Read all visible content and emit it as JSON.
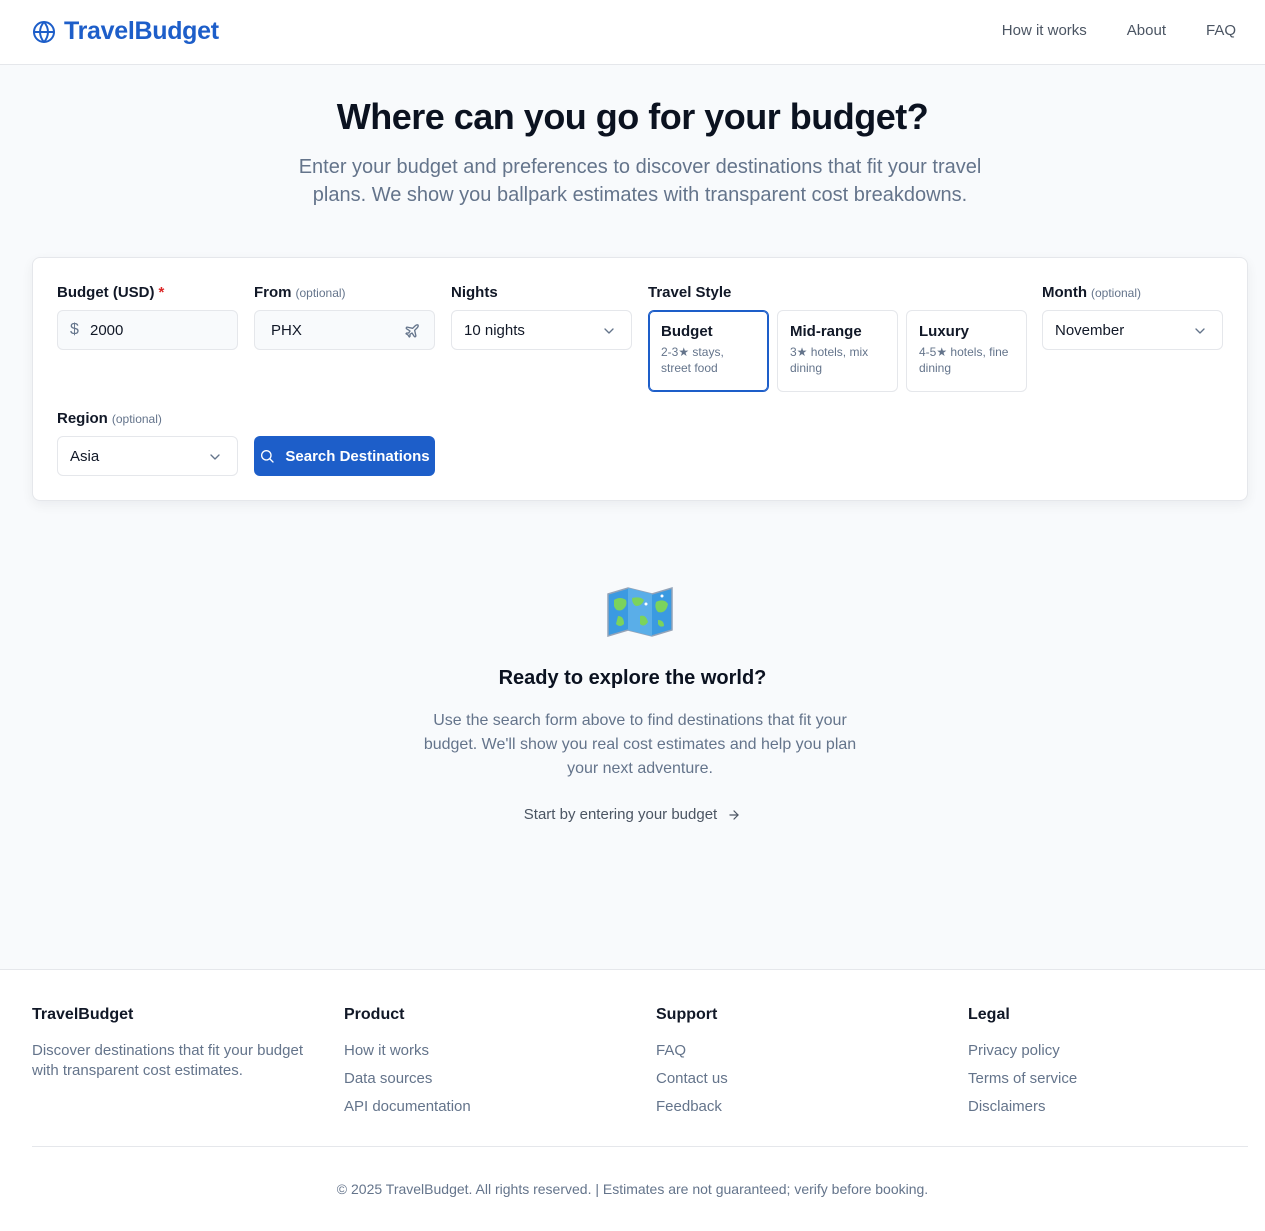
{
  "header": {
    "brand": "TravelBudget",
    "nav": [
      "How it works",
      "About",
      "FAQ"
    ]
  },
  "hero": {
    "title": "Where can you go for your budget?",
    "subtitle": "Enter your budget and preferences to discover destinations that fit your travel plans. We show you ballpark estimates with transparent cost breakdowns."
  },
  "form": {
    "budget": {
      "label": "Budget (USD)",
      "required_mark": "*",
      "currency": "$",
      "value": "2000"
    },
    "from": {
      "label": "From",
      "optional": "(optional)",
      "value": "PHX"
    },
    "nights": {
      "label": "Nights",
      "value": "10 nights"
    },
    "travel_style": {
      "label": "Travel Style",
      "selected": "Budget",
      "options": [
        {
          "title": "Budget",
          "desc": "2-3★ stays, street food"
        },
        {
          "title": "Mid-range",
          "desc": "3★ hotels, mix dining"
        },
        {
          "title": "Luxury",
          "desc": "4-5★ hotels, fine dining"
        }
      ]
    },
    "month": {
      "label": "Month",
      "optional": "(optional)",
      "value": "November"
    },
    "region": {
      "label": "Region",
      "optional": "(optional)",
      "value": "Asia"
    },
    "search_button": "Search Destinations"
  },
  "empty_state": {
    "icon": "world-map-icon",
    "title": "Ready to explore the world?",
    "text": "Use the search form above to find destinations that fit your budget. We'll show you real cost estimates and help you plan your next adventure.",
    "link": "Start by entering your budget"
  },
  "footer": {
    "brand": "TravelBudget",
    "tagline": "Discover destinations that fit your budget with transparent cost estimates.",
    "columns": [
      {
        "title": "Product",
        "links": [
          "How it works",
          "Data sources",
          "API documentation"
        ]
      },
      {
        "title": "Support",
        "links": [
          "FAQ",
          "Contact us",
          "Feedback"
        ]
      },
      {
        "title": "Legal",
        "links": [
          "Privacy policy",
          "Terms of service",
          "Disclaimers"
        ]
      }
    ],
    "copyright": "© 2025 TravelBudget. All rights reserved. | Estimates are not guaranteed; verify before booking."
  },
  "colors": {
    "accent": "#1d5ec9",
    "required": "#dc2626",
    "muted": "#64748b"
  }
}
